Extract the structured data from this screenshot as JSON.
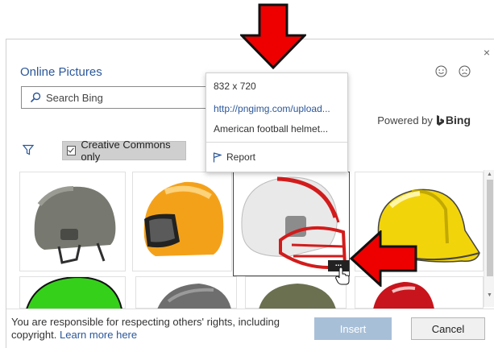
{
  "dialog": {
    "title": "Online Pictures",
    "close_glyph": "×"
  },
  "search": {
    "placeholder": "Search Bing",
    "icon": "search-icon"
  },
  "powered_by": {
    "label": "Powered by",
    "brand": "Bing"
  },
  "filters": {
    "cc_label": "Creative Commons only",
    "cc_checked": true
  },
  "popup": {
    "dimensions": "832 x 720",
    "url": "http://pngimg.com/upload...",
    "name": "American football helmet...",
    "report_label": "Report"
  },
  "footer": {
    "legal_text": "You are responsible for respecting others' rights, including copyright.",
    "learn_more": "Learn more here",
    "insert_label": "Insert",
    "cancel_label": "Cancel"
  },
  "more_button_glyph": "...",
  "colors": {
    "accent": "#2b579a",
    "insert_disabled": "#a8bfd8",
    "annotation_arrow": "#ee0000"
  },
  "thumbnails": [
    {
      "subject": "gray military helmet"
    },
    {
      "subject": "orange motorcycle helmet"
    },
    {
      "subject": "white and red football helmet",
      "selected": true
    },
    {
      "subject": "yellow hard hat"
    },
    {
      "subject": "green helmet"
    },
    {
      "subject": "gray helmet"
    },
    {
      "subject": "olive military helmet"
    },
    {
      "subject": "red helmet"
    }
  ]
}
